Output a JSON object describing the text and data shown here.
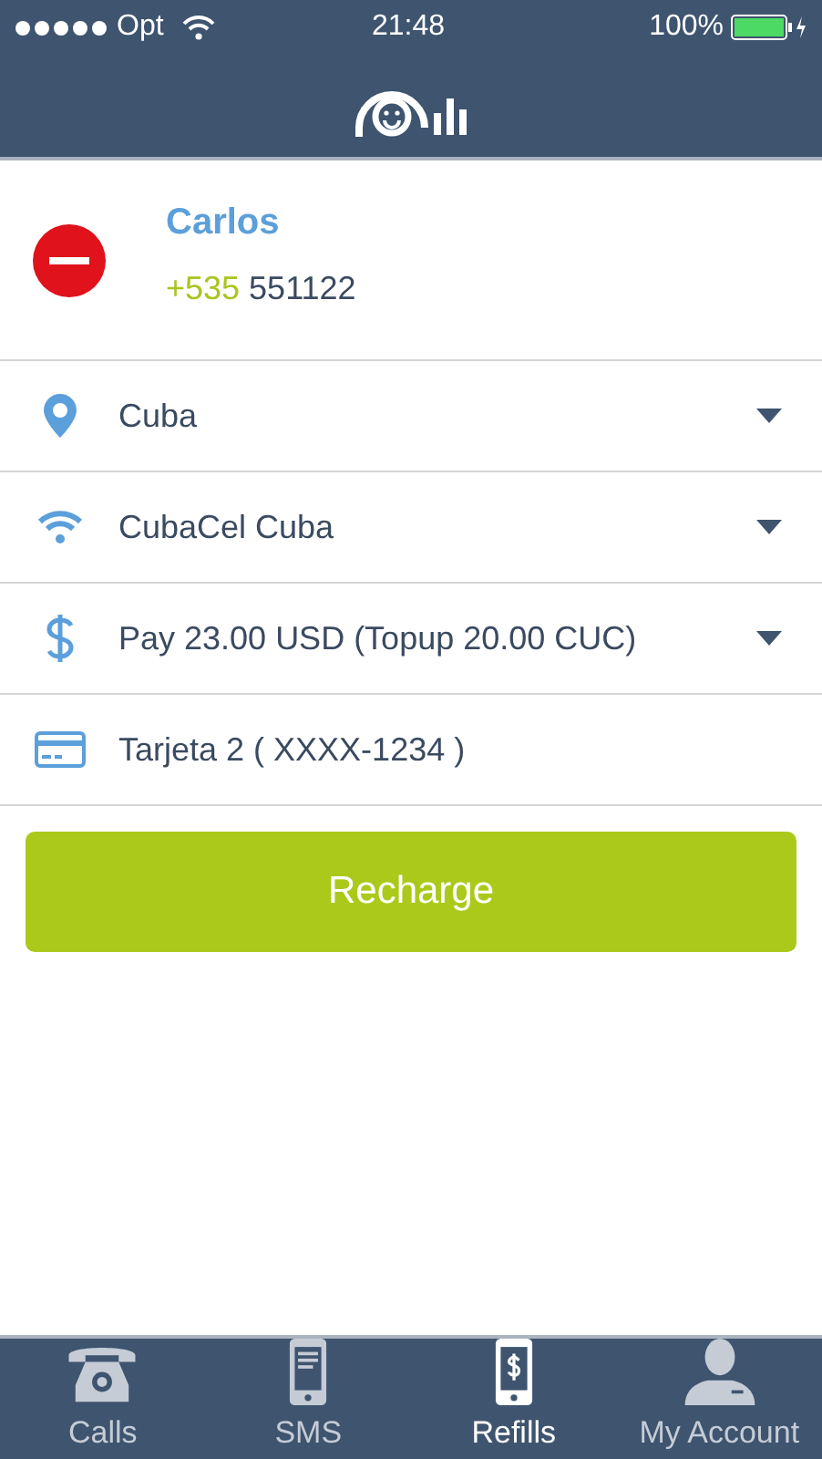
{
  "status_bar": {
    "carrier": "Opt",
    "time": "21:48",
    "battery": "100%"
  },
  "contact": {
    "name": "Carlos",
    "country_code": "+535",
    "number": "551122"
  },
  "fields": [
    {
      "kind": "dropdown",
      "value": "Cuba"
    },
    {
      "kind": "dropdown",
      "value": "CubaCel Cuba"
    },
    {
      "kind": "dropdown",
      "value": "Pay 23.00 USD (Topup 20.00 CUC)"
    },
    {
      "kind": "plain",
      "value": "Tarjeta 2 ( XXXX-1234 )"
    }
  ],
  "recharge_button": "Recharge",
  "tabs": [
    {
      "label": "Calls",
      "selected": false
    },
    {
      "label": "SMS",
      "selected": false
    },
    {
      "label": "Refills",
      "selected": true
    },
    {
      "label": "My Account",
      "selected": false
    }
  ]
}
